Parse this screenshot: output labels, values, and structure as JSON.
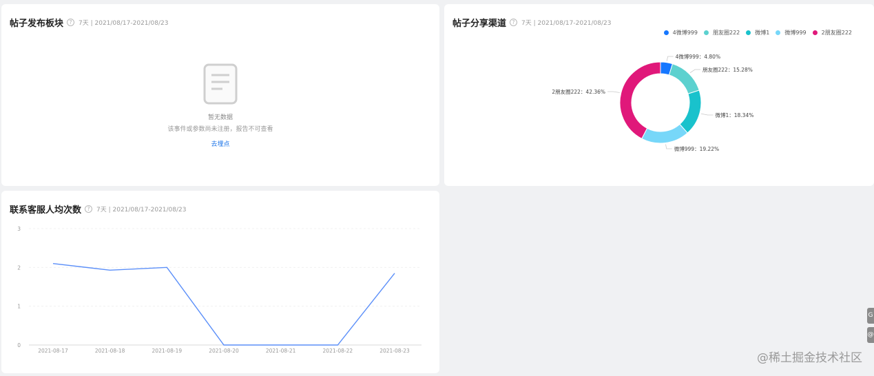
{
  "cards": {
    "posts": {
      "title": "帖子发布板块",
      "range": "7天 | 2021/08/17-2021/08/23",
      "empty_title": "暂无数据",
      "empty_desc": "该事件或参数尚未注册，报告不可查看",
      "empty_link": "去埋点"
    },
    "share": {
      "title": "帖子分享渠道",
      "range": "7天 | 2021/08/17-2021/08/23"
    },
    "contact": {
      "title": "联系客服人均次数",
      "range": "7天 | 2021/08/17-2021/08/23"
    }
  },
  "side_tabs": [
    "G",
    "@"
  ],
  "watermark": "@稀土掘金技术社区",
  "chart_data": [
    {
      "type": "pie",
      "title": "帖子分享渠道",
      "legend_position": "top-right",
      "slices": [
        {
          "name": "4微博999",
          "percent": 4.8,
          "label": "4微博999：4.80%",
          "color": "#1677ff"
        },
        {
          "name": "朋友圈222",
          "percent": 15.28,
          "label": "朋友圈222：15.28%",
          "color": "#5cd1cf"
        },
        {
          "name": "微博1",
          "percent": 18.34,
          "label": "微博1：18.34%",
          "color": "#19c2cc"
        },
        {
          "name": "微博999",
          "percent": 19.22,
          "label": "微博999：19.22%",
          "color": "#77d7f9"
        },
        {
          "name": "2朋友圈222",
          "percent": 42.36,
          "label": "2朋友圈222：42.36%",
          "color": "#e0187a"
        }
      ]
    },
    {
      "type": "line",
      "title": "联系客服人均次数",
      "categories": [
        "2021-08-17",
        "2021-08-18",
        "2021-08-19",
        "2021-08-20",
        "2021-08-21",
        "2021-08-22",
        "2021-08-23"
      ],
      "values": [
        2.1,
        1.93,
        2.0,
        0,
        0,
        0,
        1.85
      ],
      "ylim": [
        0,
        3
      ],
      "yticks": [
        "0",
        "1",
        "2",
        "3"
      ],
      "grid": true,
      "color": "#5b8ff9"
    }
  ]
}
